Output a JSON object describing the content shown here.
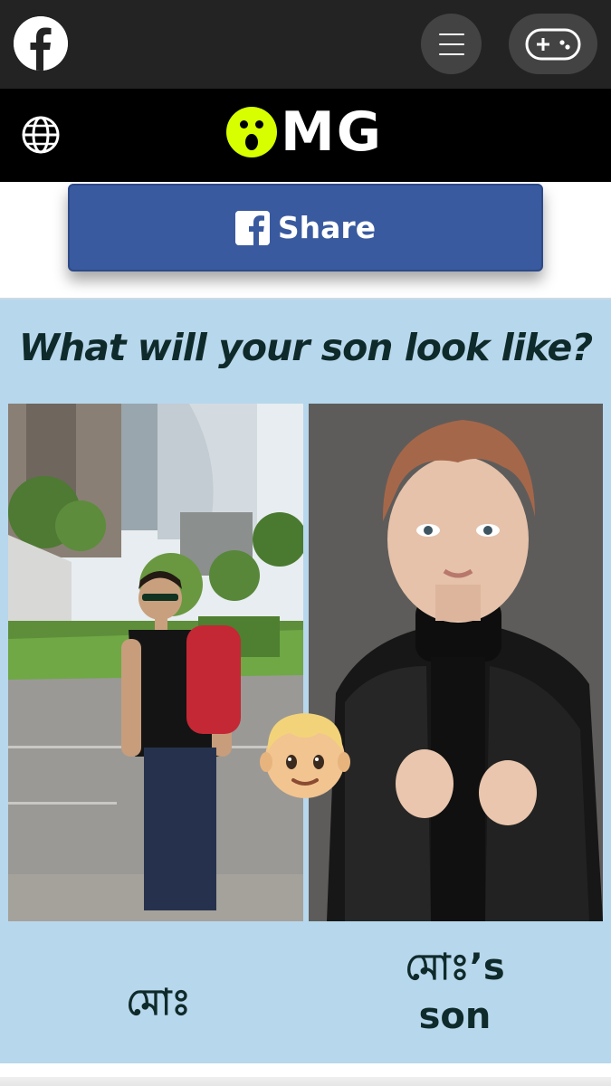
{
  "topbar": {
    "logo_icon": "facebook-icon",
    "menu_icon": "hamburger-menu-icon",
    "games_icon": "gamepad-icon"
  },
  "header": {
    "language_icon": "globe-icon",
    "brand": "MG",
    "brand_face_color": "#d7ff00"
  },
  "share": {
    "label": "Share",
    "icon": "facebook-icon",
    "color": "#3a5a9f"
  },
  "result": {
    "title": "What will your son look like?",
    "left_photo": "user-photo",
    "right_photo": "son-photo",
    "emoji": "boy-emoji",
    "left_name": "মোঃ",
    "right_name_line1": "মোঃ’s",
    "right_name_line2": "son",
    "background_color": "#b7d7ec"
  }
}
